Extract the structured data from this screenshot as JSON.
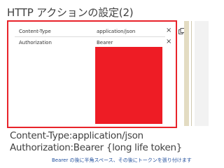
{
  "title": "HTTP アクションの設定(2)",
  "headers": [
    {
      "name": "Content-Type",
      "value": "application/json",
      "delete_icon": "×"
    },
    {
      "name": "Authorization",
      "value": "Bearer",
      "delete_icon": "×"
    }
  ],
  "icons": {
    "copy": "copy-icon",
    "delete": "close-icon"
  },
  "colors": {
    "highlight": "#e8232a",
    "value_box": "#ee1c25",
    "note": "#1f4e9c"
  },
  "callout": {
    "line1": "Content-Type:application/json",
    "line2": "Authorization:Bearer {long life token}"
  },
  "note": "Bearer の後に半角スペース、その後にトークンを張り付けます"
}
